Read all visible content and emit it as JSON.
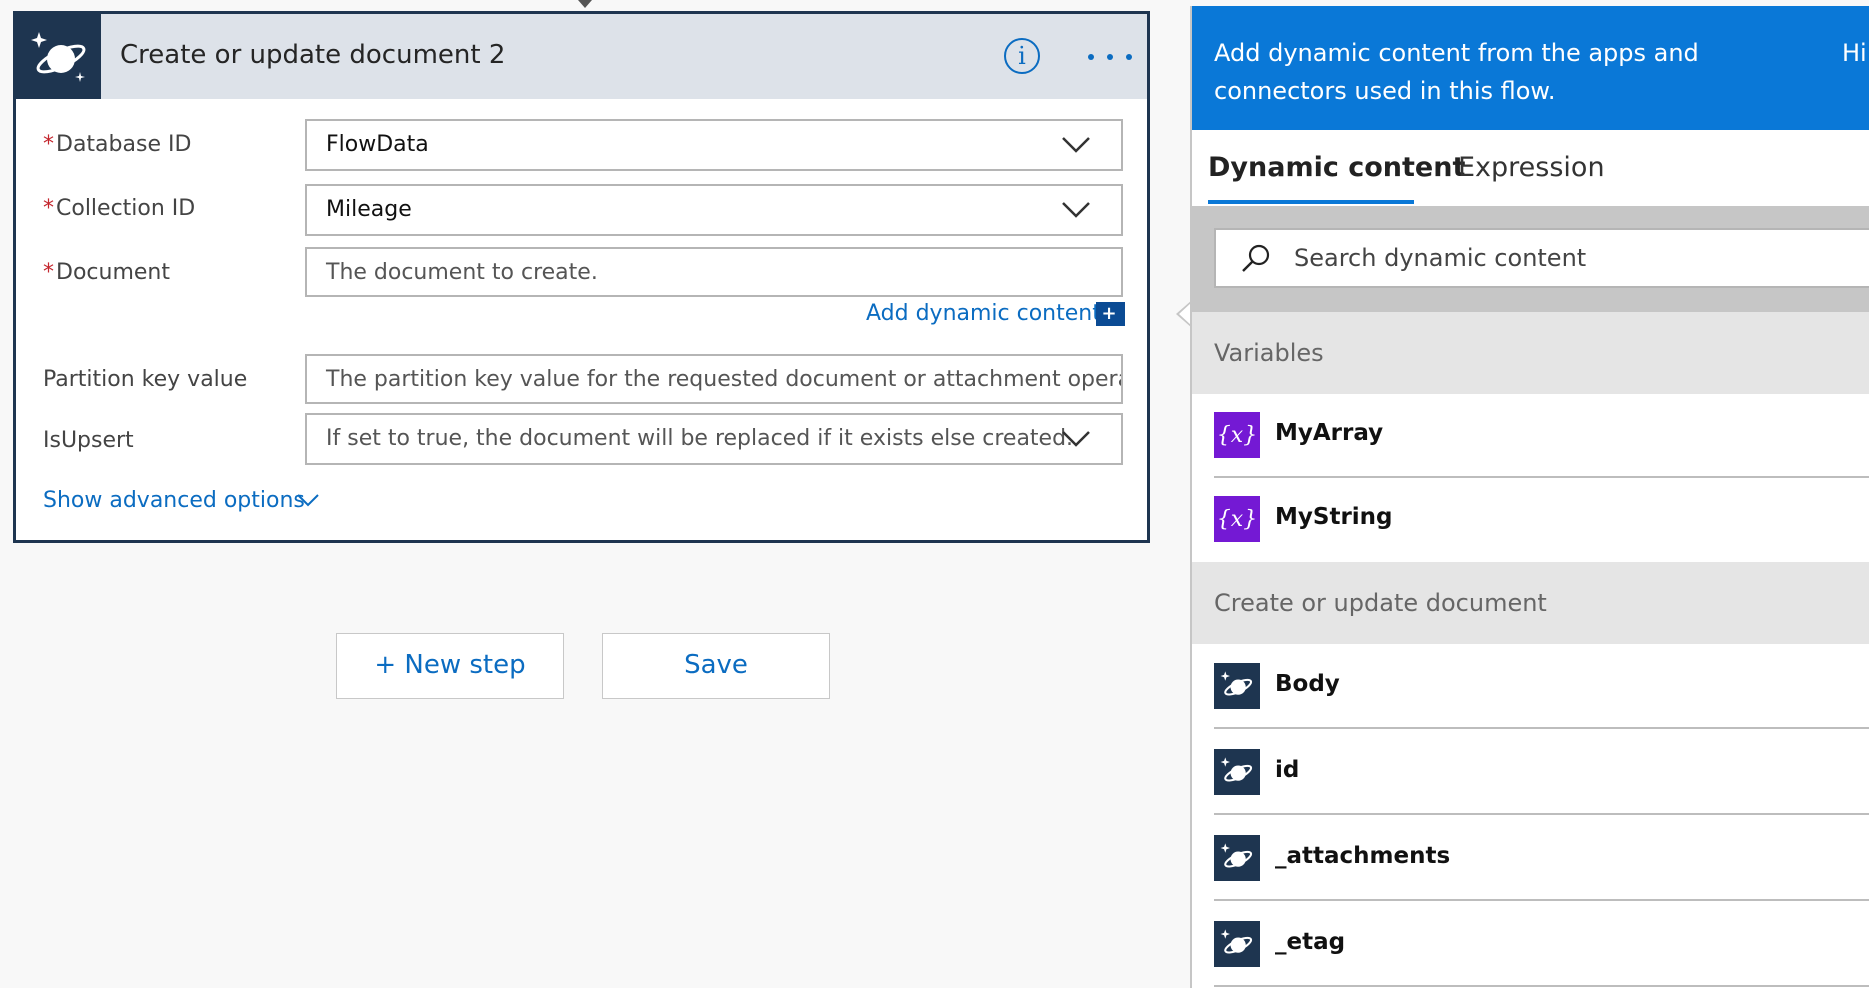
{
  "card": {
    "title": "Create or update document 2",
    "info_glyph": "i",
    "icon": "cosmos-db-icon",
    "fields": {
      "database_id": {
        "label": "Database ID",
        "required": "*",
        "value": "FlowData"
      },
      "collection_id": {
        "label": "Collection ID",
        "required": "*",
        "value": "Mileage"
      },
      "document": {
        "label": "Document",
        "required": "*",
        "placeholder": "The document to create."
      },
      "partition_key": {
        "label": "Partition key value",
        "placeholder": "The partition key value for the requested document or attachment operation."
      },
      "is_upsert": {
        "label": "IsUpsert",
        "placeholder": "If set to true, the document will be replaced if it exists else created."
      }
    },
    "add_dynamic_content": "Add dynamic content",
    "add_dynamic_glyph": "+",
    "show_advanced": "Show advanced options"
  },
  "actions": {
    "new_step": "+ New step",
    "save": "Save"
  },
  "panel": {
    "banner_text": "Add dynamic content from the apps and connectors used in this flow.",
    "banner_hide": "Hi",
    "tabs": [
      "Dynamic content",
      "Expression"
    ],
    "active_tab": "Dynamic content",
    "search_placeholder": "Search dynamic content",
    "sections": [
      {
        "title": "Variables",
        "items": [
          {
            "label": "MyArray",
            "icon_glyph": "{x}",
            "icon": "variable-icon"
          },
          {
            "label": "MyString",
            "icon_glyph": "{x}",
            "icon": "variable-icon"
          }
        ]
      },
      {
        "title": "Create or update document",
        "items": [
          {
            "label": "Body",
            "icon": "cosmos-db-icon"
          },
          {
            "label": "id",
            "icon": "cosmos-db-icon"
          },
          {
            "label": "_attachments",
            "icon": "cosmos-db-icon"
          },
          {
            "label": "_etag",
            "icon": "cosmos-db-icon"
          }
        ]
      }
    ]
  },
  "colors": {
    "accent": "#0a78d7",
    "link": "#0b6cc1",
    "card_border": "#1e3550",
    "variable_icon": "#7419d4",
    "required": "#c4262e"
  }
}
